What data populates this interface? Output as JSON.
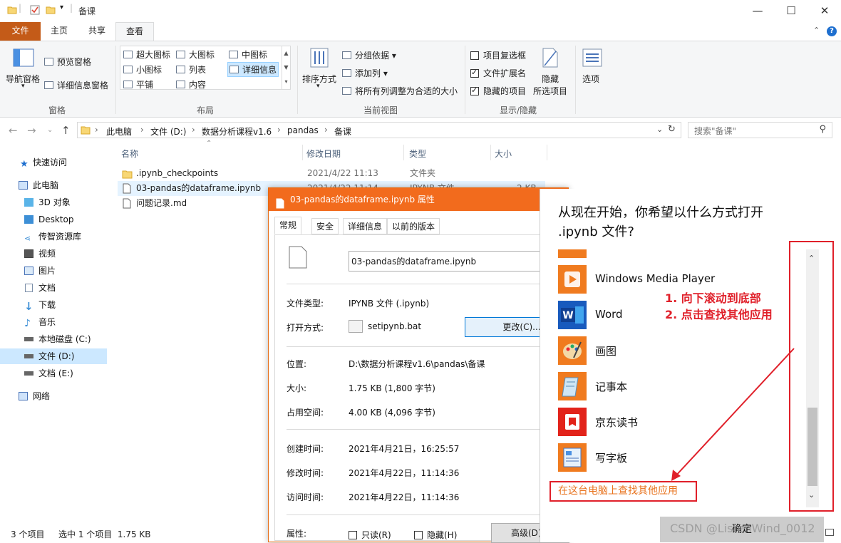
{
  "window": {
    "title": "备课",
    "minimize": "—",
    "maximize": "☐",
    "close": "✕"
  },
  "ribbon": {
    "tabs": [
      "文件",
      "主页",
      "共享",
      "查看"
    ],
    "active_tab": "查看",
    "panes": {
      "nav_pane": "导航窗格",
      "preview_pane": "预览窗格",
      "details_pane": "详细信息窗格",
      "group_label": "窗格"
    },
    "layout": {
      "items": [
        "超大图标",
        "大图标",
        "中图标",
        "小图标",
        "列表",
        "详细信息",
        "平铺",
        "内容"
      ],
      "selected": "详细信息",
      "group_label": "布局"
    },
    "current_view": {
      "sort_by": "排序方式",
      "group_by": "分组依据",
      "add_column": "添加列",
      "fit_columns": "将所有列调整为合适的大小",
      "group_label": "当前视图"
    },
    "show_hide": {
      "item_checkboxes": "项目复选框",
      "file_extensions": "文件扩展名",
      "hidden_items": "隐藏的项目",
      "hide_selected": "隐藏",
      "hide_selected_2": "所选项目",
      "group_label": "显示/隐藏"
    },
    "options": "选项"
  },
  "address": {
    "crumbs": [
      "此电脑",
      "文件 (D:)",
      "数据分析课程v1.6",
      "pandas",
      "备课"
    ],
    "search_placeholder": "搜索\"备课\""
  },
  "nav_pane": {
    "items": [
      "快速访问",
      "此电脑",
      "3D 对象",
      "Desktop",
      "传智资源库",
      "视频",
      "图片",
      "文档",
      "下载",
      "音乐",
      "本地磁盘 (C:)",
      "文件 (D:)",
      "文档 (E:)",
      "网络"
    ],
    "selected": "文件 (D:)"
  },
  "files": {
    "columns": [
      "名称",
      "修改日期",
      "类型",
      "大小"
    ],
    "rows": [
      {
        "name": ".ipynb_checkpoints",
        "date": "2021/4/22 11:13",
        "type": "文件夹",
        "size": ""
      },
      {
        "name": "03-pandas的dataframe.ipynb",
        "date": "2021/4/22 11:14",
        "type": "IPYNB 文件",
        "size": "2 KB"
      },
      {
        "name": "问题记录.md",
        "date": "",
        "type": "",
        "size": ""
      }
    ]
  },
  "status": {
    "count": "3 个项目",
    "selected": "选中 1 个项目  1.75 KB"
  },
  "properties": {
    "title": "03-pandas的dataframe.ipynb 属性",
    "tabs": [
      "常规",
      "安全",
      "详细信息",
      "以前的版本"
    ],
    "filename": "03-pandas的dataframe.ipynb",
    "file_type_label": "文件类型:",
    "file_type": "IPYNB 文件 (.ipynb)",
    "open_with_label": "打开方式:",
    "open_with": "setipynb.bat",
    "change_button": "更改(C)...",
    "location_label": "位置:",
    "location": "D:\\数据分析课程v1.6\\pandas\\备课",
    "size_label": "大小:",
    "size": "1.75 KB (1,800 字节)",
    "disk_size_label": "占用空间:",
    "disk_size": "4.00 KB (4,096 字节)",
    "created_label": "创建时间:",
    "created": "2021年4月21日，16:25:57",
    "modified_label": "修改时间:",
    "modified": "2021年4月22日，11:14:36",
    "accessed_label": "访问时间:",
    "accessed": "2021年4月22日，11:14:36",
    "attributes_label": "属性:",
    "readonly": "只读(R)",
    "hidden": "隐藏(H)",
    "advanced_button": "高级(D)..."
  },
  "open_with": {
    "question": "从现在开始，你希望以什么方式打开 .ipynb 文件?",
    "apps": [
      "Windows Media Player",
      "Word",
      "画图",
      "记事本",
      "京东读书",
      "写字板"
    ],
    "find_other": "在这台电脑上查找其他应用",
    "annotation_1": "1. 向下滚动到底部",
    "annotation_2": "2. 点击查找其他应用",
    "ok_button": "确定"
  },
  "watermark": "CSDN @ListenWind_0012",
  "colors": {
    "file_tab": "#c45b18",
    "dialog_title": "#f26b1d",
    "annotation_red": "#e0202a",
    "find_link": "#e8731e",
    "selection": "#cce8ff"
  }
}
